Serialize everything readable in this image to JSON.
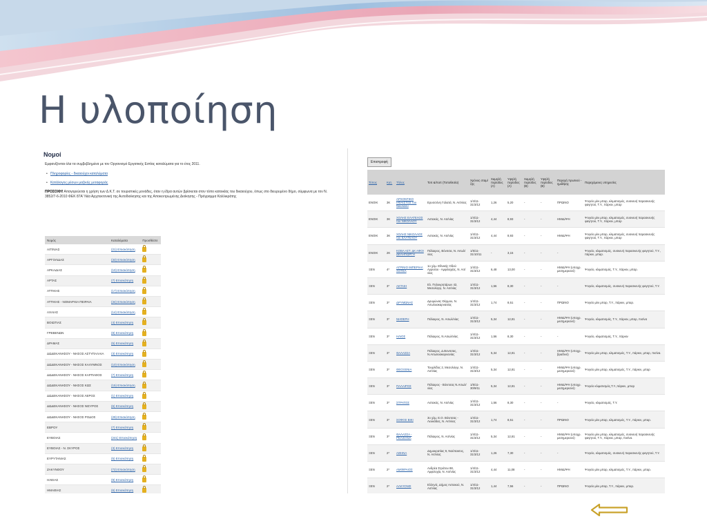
{
  "slide": {
    "title": "Η υλοποίηση"
  },
  "left": {
    "heading": "Νομοί",
    "intro": "Εμφανίζονται όλα τα συμβεβλημένα με τον Οργανισμό Εργατικής Εστίας καταλύματα για το έτος 2011.",
    "links": [
      "Πληροφορίες - δικαιούχοι καταλύματα",
      "Κατάλογος μέσων μαζικής μεταφοράς"
    ],
    "notice_label": "ΠΡΟΣΟΧΗ!",
    "notice": "Απαγορεύεται η χρήση των Δ.Κ.Τ. σε τουριστικές μονάδες, όταν η έδρα αυτών βρίσκεται στον τόπο κατοικίας του δικαιούχου, όπως στο διευρυμένο δήμο, σύμφωνα με τον Ν. 3852/7-6-2010 ΦΕΚ 87Α' Νέα Αρχιτεκτονική της Αυτοδιοίκησης και της Αποκεντρωμένης Διοίκησης - Πρόγραμμα Καλλικράτης",
    "table": {
      "headers": [
        "Νομός",
        "Καταλύματα",
        "Προσθέστε"
      ],
      "rows": [
        [
          "ΑΙΤ/ΝΙΑΣ",
          "(21) Επισκόπηση"
        ],
        [
          "ΑΡΓΟΛΙΔΑΣ",
          "(33) Επισκόπηση"
        ],
        [
          "ΑΡΚΑΔΙΑΣ",
          "(10) Επισκόπηση"
        ],
        [
          "ΑΡΤΑΣ",
          "(7) Επισκόπηση"
        ],
        [
          "ΑΤΤΙΚΗΣ",
          "(17) Επισκόπηση"
        ],
        [
          "ΑΤΤΙΚΗΣ - ΝΟΜΑΡΧΙΑ ΠΕΙΡΑΙΑ",
          "(34) Επισκόπηση"
        ],
        [
          "ΑΧΑΙΑΣ",
          "(14) Επισκόπηση"
        ],
        [
          "ΒΟΙΩΤΙΑΣ",
          "(4) Επισκόπηση"
        ],
        [
          "ΓΡΕΒΕΝΩΝ",
          "(8) Επισκόπηση"
        ],
        [
          "ΔΡΑΜΑΣ",
          "(5) Επισκόπηση"
        ],
        [
          "ΔΩΔΕΚΑΝΗΣΟΥ - ΝΗΣΟΣ ΑΣΤΥΠΑΛΑΙΑ",
          "(3) Επισκόπηση"
        ],
        [
          "ΔΩΔΕΚΑΝΗΣΟΥ - ΝΗΣΟΣ ΚΑΛΥΜΝΟΣ",
          "(10) Επισκόπηση"
        ],
        [
          "ΔΩΔΕΚΑΝΗΣΟΥ - ΝΗΣΟΣ ΚΑΡΠΑΘΟΣ",
          "(7) Επισκόπηση"
        ],
        [
          "ΔΩΔΕΚΑΝΗΣΟΥ - ΝΗΣΟΣ ΚΩΣ",
          "(15) Επισκόπηση"
        ],
        [
          "ΔΩΔΕΚΑΝΗΣΟΥ - ΝΗΣΟΣ ΛΕΡΟΣ",
          "(1) Επισκόπηση"
        ],
        [
          "ΔΩΔΕΚΑΝΗΣΟΥ - ΝΗΣΟΣ ΝΙΣΥΡΟΣ",
          "(6) Επισκόπηση"
        ],
        [
          "ΔΩΔΕΚΑΝΗΣΟΥ - ΝΗΣΟΣ ΡΟΔΟΣ",
          "(29) Επισκόπηση"
        ],
        [
          "ΕΒΡΟΥ",
          "(7) Επισκόπηση"
        ],
        [
          "ΕΥΒΟΙΑΣ",
          "(241) Επισκόπηση"
        ],
        [
          "ΕΥΒΟΙΑΣ - Ν. ΣΚΥΡΟΣ",
          "(3) Επισκόπηση"
        ],
        [
          "ΕΥΡΥΤΑΝΙΑΣ",
          "(5) Επισκόπηση"
        ],
        [
          "ΖΑΚΥΝΘΟΥ",
          "(72) Επισκόπηση"
        ],
        [
          "ΗΛΕΙΑΣ",
          "(9) Επισκόπηση"
        ],
        [
          "ΗΜΑΘΙΑΣ",
          "(6) Επισκόπηση"
        ]
      ]
    }
  },
  "right": {
    "back_button": "Επιστροφή",
    "table": {
      "headers": [
        "Τύπος",
        "Κατ.",
        "Τίτλος",
        "Τοπ &/ποπ (Τοποθεσία)",
        "Χρόνος σταμ/ζης",
        "Χαμηλή περίοδος (Α)",
        "Υψηλή περίοδος (Α)",
        "Χαμηλή περίοδος (Β)",
        "Υψηλή περίοδος (Β)",
        "Παροχή πρωϊνού - ημιδ/ψης",
        "Παρεχόμενες υπηρεσίες"
      ],
      "rows": [
        [
          "ΕΝΟΙΚ",
          "3Κ",
          "ΑΡΧΟΝΤΙΚΟ ΗΦΑΙΣΤΟΣ του Νικολάου",
          "Ερυσσόνη Γαλατά, Ν. Αιτ/νίας",
          "1/4/11-31/3/12",
          "1,26",
          "5,20",
          "-",
          "-",
          "ΠΡΩΙΝΟ",
          "Ψυγείο μίνι μπαρ, κλιματισμός, συσκευή παρασκευής φαγητού, Τ.Υ., πάρκιν, μπαρ"
        ],
        [
          "ΕΝΟΙΚ",
          "3Κ",
          "ΧΟΛΗΣ ΕΛΑΤΕΛΟΣ του ΝΙΚΟΛΑΟΥ",
          "Αστακός, Ν. Αιτ/νίας",
          "1/4/11-31/3/12",
          "4,44",
          "8,93",
          "-",
          "-",
          "ΗΜΙΔ/ΨΗ",
          "Ψυγείο μίνι μπαρ, κλιματισμός, συσκευή παρασκευής φαγητού, Τ.Υ., πάρκιν, μπαρ"
        ],
        [
          "ΕΝΟΙΚ",
          "3Κ",
          "ΧΟΛΗΣ ΝΙΚΟΛΑΟΣ του ΕΛΑΤΕΛΟΥ",
          "Αστακός, Ν. Αιτ/νίας",
          "1/4/11-31/3/12",
          "4,44",
          "8,93",
          "-",
          "-",
          "ΗΜΙΔ/ΨΗ",
          "Ψυγείο μίνι μπαρ, κλιματισμός, συσκευή παρασκευής φαγητού, Τ.Υ., πάρκιν, μπαρ"
        ],
        [
          "ΕΝΟΙΚ",
          "2Κ",
          "ΚΟΒΑ ΑΣΤ. ΔΚ ΑΦΟΙ ΔΕΛΗΓΙΩΡΓΗ",
          "Πάλαιρος, Βόνιτσα, Ν. Αιτωλ/νίας",
          "1/5/11-31/10/11",
          "-",
          "3,15",
          "-",
          "-",
          "-",
          "Ψυγείο, κλιματισμός, συσκευή παρασκευής φαγητού, Τ.Υ., πάρκιν, μπαρ."
        ],
        [
          "ΞΕΝ",
          "4*",
          "ΑΓΡΙΝΙΟ ΙΜΠΕΡΙΑΛ ΧΟΤΕΛ",
          "1o χλμ. Εθνικής Οδού Αγρινίου - Αμφιλοχίας, Ν. Αιτ/νίας",
          "1/4/11-31/3/12",
          "6,48",
          "13,00",
          "-",
          "-",
          "ΗΜΙΔ/ΨΗ (υποχρ. μεσημεριανό)",
          "Ψυγείο, κλιματισμός, Τ.Υ., πάρκιν, μπαρ."
        ],
        [
          "ΞΕΝ",
          "3*",
          "ΑΚΤΑΙΗ",
          "Ελ. Πολυκρητάρων 42, Μεσολόγγι, Ν. Αιτ/νίας",
          "1/4/11-31/3/12",
          "1,56",
          "8,30",
          "-",
          "-",
          "-",
          "Ψυγείο, κλιματισμός, συσκευή παρασκευής φαγητού, Τ.Υ."
        ],
        [
          "ΞΕΝ",
          "3*",
          "ΔΡΥΜΩΝΑΣ",
          "Δρυμώνας Θέρμου, Ν. Αιτωλοακαρνανίας",
          "1/4/11-31/3/12",
          "1,74",
          "8,51",
          "-",
          "-",
          "ΠΡΩΙΝΟ",
          "Ψυγείο μίνι μπαρ, Τ.Υ., πάρκιν, μπαρ."
        ],
        [
          "ΞΕΝ",
          "3*",
          "ΝΗΦΕΡΗ",
          "Πάλαιρος, Ν. Αιτωλ/νίας",
          "1/4/11-31/3/12",
          "5,34",
          "12,81",
          "-",
          "-",
          "ΗΜΙΔ/ΨΗ (υποχρ. μεσημεριανό)",
          "Ψυγείο, κλιματισμός, Τ.Υ., πάρκιν, μπαρ, πισίνα"
        ],
        [
          "ΞΕΝ",
          "3*",
          "ΗΛΙΟΣ",
          "Πάλαιρος, Ν.Αιτωλ/νίας",
          "1/4/11-31/3/12",
          "1,56",
          "8,30",
          "-",
          "-",
          "-",
          "Ψυγείο, κλιματισμός, Τ.Υ., πάρκιν"
        ],
        [
          "ΞΕΝ",
          "3*",
          "ΘΑΛΑΣΣΑ",
          "Πάλαιρος, Δ.Βονιτσας, Ν.Αιτωλοακαρνανίας",
          "1/4/11-31/3/12",
          "5,34",
          "12,81",
          "-",
          "-",
          "ΗΜΙΔ/ΨΗ (υποχρ. βραδινό)",
          "Ψυγείο μίνι μπαρ, κλιματισμός, Τ.Υ., πάρκιν, μπαρ, πισίνα."
        ],
        [
          "ΞΕΝ",
          "3*",
          "ΘΕΟΞΕΝΙΑ",
          "Τουρλίδος 2, Μεσολόγγι, Ν. Αιτ/νίας",
          "1/4/11-31/3/12",
          "5,34",
          "12,81",
          "-",
          "-",
          "ΗΜΙΔ/ΨΗ (υποχρ. μεσημεριανό)",
          "Ψυγείο μίνι μπαρ, κλιματισμός, Τ.Υ., πάρκιν, μπαρ"
        ],
        [
          "ΞΕΝ",
          "3*",
          "ΠΑΛΑΙΡΟΣ",
          "Πάλαιρος - Βόνιτσας Ν.Αιτωλ/νίας",
          "1/5/11-30/9/11",
          "5,34",
          "12,81",
          "-",
          "-",
          "ΗΜΙΔ/ΨΗ (υποχρ. μεσημεριανό)",
          "Ψυγείο κλιματισμός,Τ.Υ.,πάρκιν, μπαρ"
        ],
        [
          "ΞΕΝ",
          "3*",
          "ΣΤΡΑΤΟΣ",
          "Αστακός, Ν. Αιτ/νίας",
          "1/4/11-31/3/12",
          "1,56",
          "8,30",
          "-",
          "-",
          "-",
          "Ψυγείο, κλιματισμός, Τ.Υ."
        ],
        [
          "ΞΕΝ",
          "3*",
          "ΣΟΦΟΣ ΒΙΚΙ",
          "3o χλμ. Ε.Ο. Βόνιτσας - Λευκάδας, Ν. Αιτ/νίας",
          "1/4/11-31/3/12",
          "1,74",
          "8,51",
          "-",
          "-",
          "ΠΡΩΙΝΟ",
          "Ψυγείο μίνι μπαρ, κλιματισμός, Τ.Υ., πάρκιν, μπαρ."
        ],
        [
          "ΞΕΝ",
          "3*",
          "ΘΑΛΑΣΣΑ - ΡΕΛΙΧΑΝΑ",
          "Πάλαιρος, Ν. Αιτ/νίας",
          "1/4/11-31/3/12",
          "5,34",
          "12,81",
          "-",
          "-",
          "ΗΜΙΔ/ΨΗ (υποχρ. μεσημεριανό)",
          "Ψυγείο μίνι μπαρ, κλιματισμός, συσκευή παρασκευής φαγητού, Τ.Υ., πάρκιν, μπαρ, πισίνα."
        ],
        [
          "ΞΕΝ",
          "2*",
          "ΑΘΗΝΑ",
          "Δημοκρατίας 9, Ναύπακτος, Ν. Αιτ/νίας",
          "1/4/11-31/3/12",
          "1,26",
          "7,30",
          "-",
          "-",
          "-",
          "Ψυγείο, κλιματισμός, συσκευή παρασκευής φαγητού, Τ.Υ."
        ],
        [
          "ΞΕΝ",
          "2*",
          "ΑΜΦΙΡΑΙΟΣ",
          "Ανδρέα Στράτου 88, Αμφιλοχία, Ν. Αιτ/νίας",
          "1/4/11-31/3/12",
          "4,44",
          "11,08",
          "-",
          "-",
          "ΗΜΙΔ/ΨΗ",
          "Ψυγείο μίνι μπαρ, κλιματισμός, Τ.Υ., πάρκιν, μπαρ."
        ],
        [
          "ΞΕΝ",
          "2*",
          "ΑΛΚΥΟΝΙΣ",
          "Ελληνίς, Δήμος Αστακού, Ν. Αιτ/νίας",
          "1/4/11-31/3/12",
          "1,44",
          "7,56",
          "-",
          "-",
          "ΠΡΩΙΝΟ",
          "Ψυγείο μίνι μπαρ, Τ.Υ., πάρκιν, μπαρ."
        ]
      ]
    }
  },
  "colors": {
    "title": "#4a556a",
    "link": "#2a62a8",
    "arrow": "#c9a22a",
    "swoosh_pink": "#e8a3b3",
    "swoosh_blue": "#8fb4d8"
  }
}
